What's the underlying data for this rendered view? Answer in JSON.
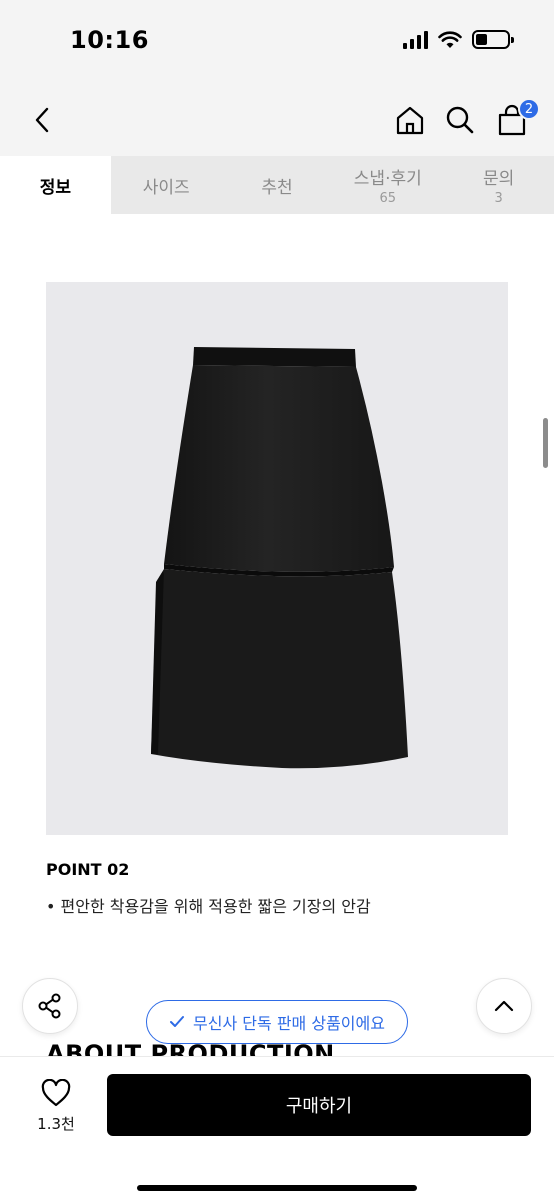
{
  "status_bar": {
    "time": "10:16",
    "battery_level": 0.35
  },
  "header": {
    "back_icon": "chevron-left-icon",
    "home_icon": "home-icon",
    "search_icon": "search-icon",
    "cart_icon": "shopping-bag-icon",
    "cart_badge": "2"
  },
  "tabs": [
    {
      "label": "정보",
      "count": ""
    },
    {
      "label": "사이즈",
      "count": ""
    },
    {
      "label": "추천",
      "count": ""
    },
    {
      "label": "스냅·후기",
      "count": "65"
    },
    {
      "label": "문의",
      "count": "3"
    }
  ],
  "content": {
    "point_title": "POINT 02",
    "point_desc": "• 편안한 착용감을 위해 적용한 짧은 기장의 안감",
    "about_title": "ABOUT PRODUCTION"
  },
  "floating": {
    "share_icon": "share-icon",
    "top_icon": "chevron-up-icon",
    "exclusive_label": "무신사 단독 판매 상품이에요",
    "exclusive_icon": "check-icon"
  },
  "bottom_bar": {
    "like_icon": "heart-icon",
    "like_count": "1.3천",
    "buy_label": "구매하기"
  },
  "colors": {
    "accent_blue": "#2e6be6",
    "buy_button": "#000000",
    "image_bg": "#e9e9ec"
  }
}
